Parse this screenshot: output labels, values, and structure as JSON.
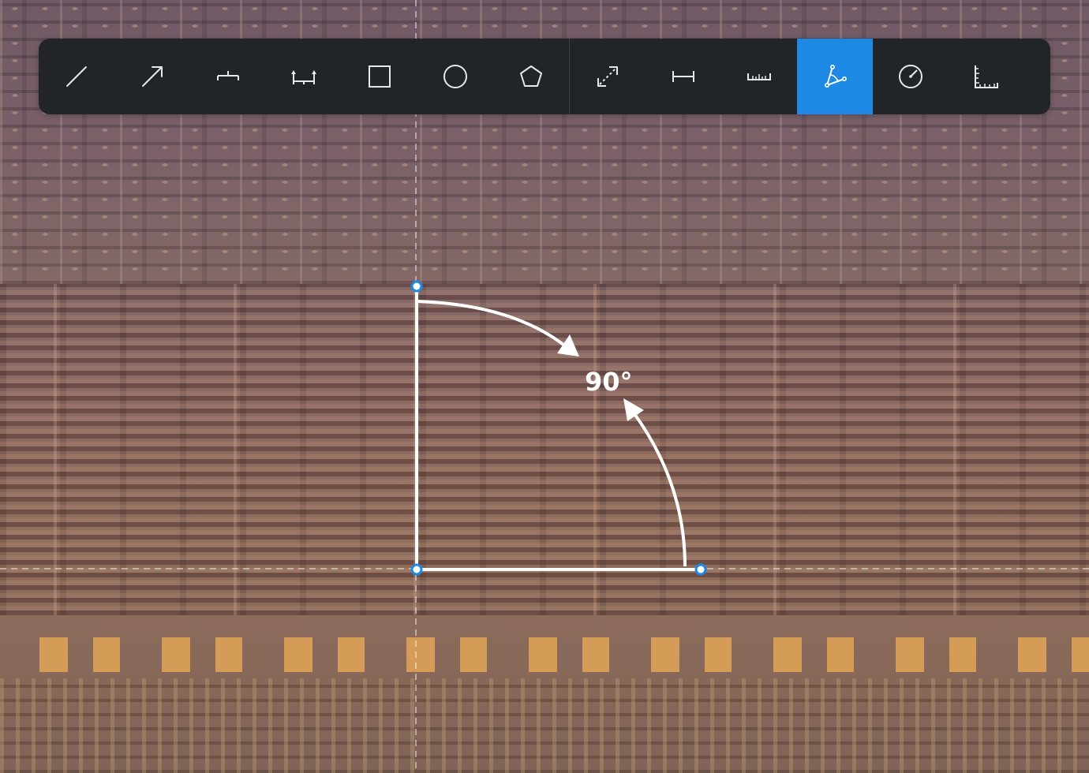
{
  "toolbar": {
    "drawing_tools": [
      {
        "name": "line-tool",
        "icon": "line-icon"
      },
      {
        "name": "arrow-tool",
        "icon": "arrow-icon"
      },
      {
        "name": "offset-line-tool",
        "icon": "offset-line-icon"
      },
      {
        "name": "baseline-tool",
        "icon": "baseline-arrows-icon"
      },
      {
        "name": "rectangle-tool",
        "icon": "square-icon"
      },
      {
        "name": "circle-tool",
        "icon": "circle-icon"
      },
      {
        "name": "polygon-tool",
        "icon": "pentagon-icon"
      }
    ],
    "measure_tools": [
      {
        "name": "distance-tool",
        "icon": "diagonal-double-arrow-icon"
      },
      {
        "name": "width-tool",
        "icon": "horizontal-dimension-icon"
      },
      {
        "name": "ruler-tool",
        "icon": "ruler-icon"
      },
      {
        "name": "angle-tool",
        "icon": "angle-icon",
        "active": true
      },
      {
        "name": "radius-tool",
        "icon": "circle-radius-icon"
      },
      {
        "name": "corner-ruler-tool",
        "icon": "corner-ruler-icon"
      }
    ],
    "active_color": "#1e88e5",
    "background_color": "#212529"
  },
  "measurement": {
    "angle_label": "90°",
    "handle_color": "#1e88e5"
  }
}
